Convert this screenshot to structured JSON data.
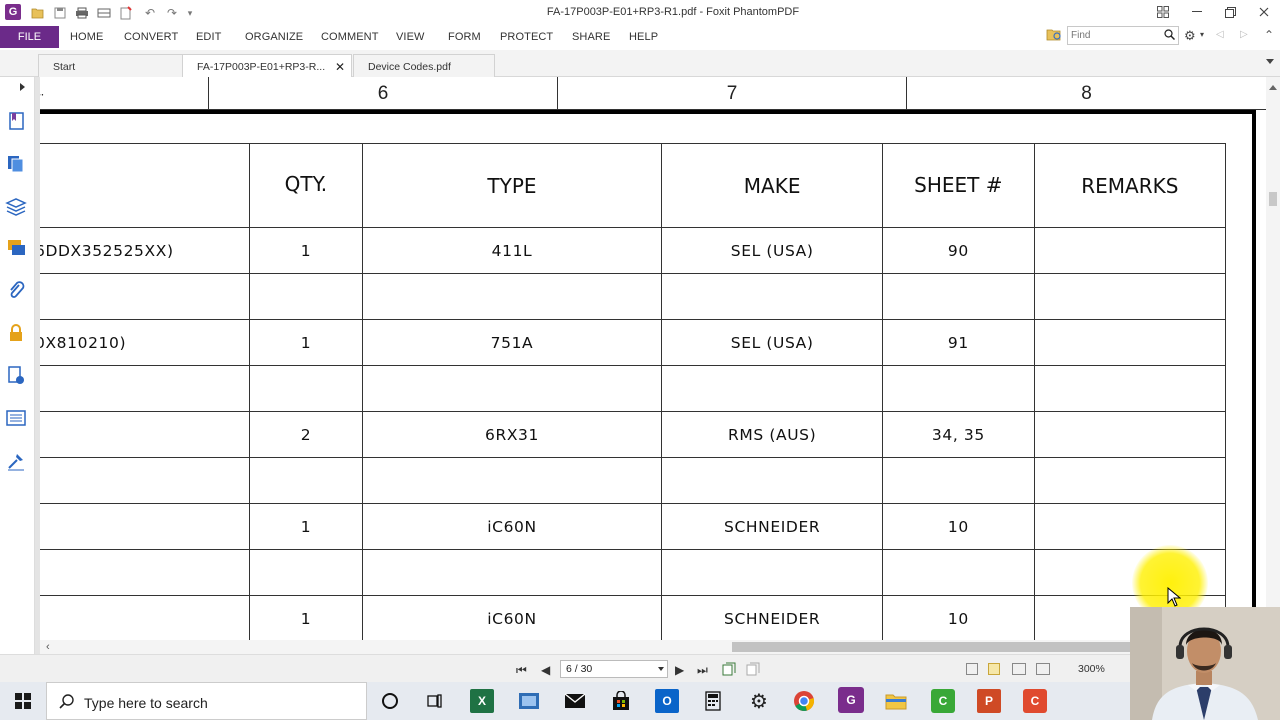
{
  "window": {
    "title": "FA-17P003P-E01+RP3-R1.pdf - Foxit PhantomPDF",
    "app_color": "#6b2a89"
  },
  "menu": {
    "file": "FILE",
    "items": [
      "HOME",
      "CONVERT",
      "EDIT",
      "ORGANIZE",
      "COMMENT",
      "VIEW",
      "FORM",
      "PROTECT",
      "SHARE",
      "HELP"
    ]
  },
  "find": {
    "placeholder": "Find"
  },
  "tabs": [
    "Start",
    "FA-17P003P-E01+RP3-R...",
    "Device Codes.pdf"
  ],
  "drawing": {
    "zones": [
      "6",
      "7",
      "8"
    ],
    "headers": [
      "QTY.",
      "TYPE",
      "MAKE",
      "SHEET #",
      "REMARKS"
    ],
    "rows": [
      {
        "desc": "6DDX352525XX)",
        "qty": "1",
        "type": "411L",
        "make": "SEL (USA)",
        "sheet": "90",
        "remarks": ""
      },
      {
        "desc": "",
        "qty": "",
        "type": "",
        "make": "",
        "sheet": "",
        "remarks": ""
      },
      {
        "desc": "0X810210)",
        "qty": "1",
        "type": "751A",
        "make": "SEL (USA)",
        "sheet": "91",
        "remarks": ""
      },
      {
        "desc": "",
        "qty": "",
        "type": "",
        "make": "",
        "sheet": "",
        "remarks": ""
      },
      {
        "desc": "",
        "qty": "2",
        "type": "6RX31",
        "make": "RMS (AUS)",
        "sheet": "34, 35",
        "remarks": ""
      },
      {
        "desc": "",
        "qty": "",
        "type": "",
        "make": "",
        "sheet": "",
        "remarks": ""
      },
      {
        "desc": "",
        "qty": "1",
        "type": "iC60N",
        "make": "SCHNEIDER",
        "sheet": "10",
        "remarks": ""
      },
      {
        "desc": "",
        "qty": "",
        "type": "",
        "make": "",
        "sheet": "",
        "remarks": ""
      },
      {
        "desc": "",
        "qty": "1",
        "type": "iC60N",
        "make": "SCHNEIDER",
        "sheet": "10",
        "remarks": ""
      }
    ]
  },
  "status": {
    "page": "6 / 30",
    "zoom": "300%"
  },
  "taskbar": {
    "search_placeholder": "Type here to search",
    "icons": [
      "cortana-icon",
      "task-view-icon",
      "excel-icon",
      "snipping-icon",
      "mail-icon",
      "store-icon",
      "outlook-icon",
      "calculator-icon",
      "settings-icon",
      "chrome-icon",
      "foxit-icon",
      "file-explorer-icon",
      "camtasia-icon",
      "powerpoint-icon",
      "recorder-icon"
    ]
  }
}
